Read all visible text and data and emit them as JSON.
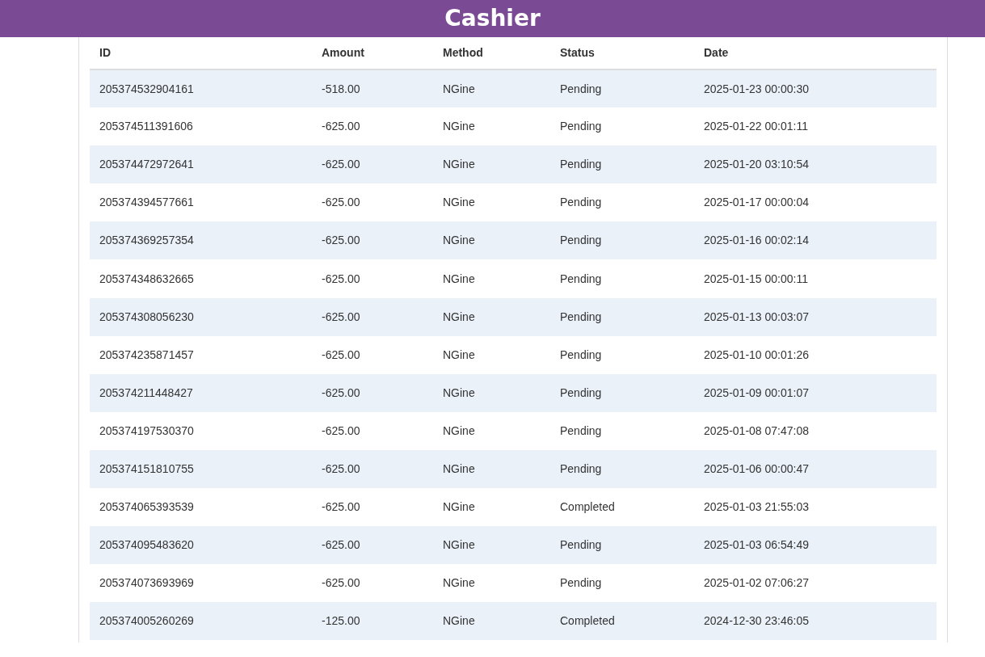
{
  "header": {
    "title": "Cashier"
  },
  "table": {
    "columns": [
      "ID",
      "Amount",
      "Method",
      "Status",
      "Date"
    ],
    "rows": [
      [
        "205374532904161",
        "-518.00",
        "NGine",
        "Pending",
        "2025-01-23 00:00:30"
      ],
      [
        "205374511391606",
        "-625.00",
        "NGine",
        "Pending",
        "2025-01-22 00:01:11"
      ],
      [
        "205374472972641",
        "-625.00",
        "NGine",
        "Pending",
        "2025-01-20 03:10:54"
      ],
      [
        "205374394577661",
        "-625.00",
        "NGine",
        "Pending",
        "2025-01-17 00:00:04"
      ],
      [
        "205374369257354",
        "-625.00",
        "NGine",
        "Pending",
        "2025-01-16 00:02:14"
      ],
      [
        "205374348632665",
        "-625.00",
        "NGine",
        "Pending",
        "2025-01-15 00:00:11"
      ],
      [
        "205374308056230",
        "-625.00",
        "NGine",
        "Pending",
        "2025-01-13 00:03:07"
      ],
      [
        "205374235871457",
        "-625.00",
        "NGine",
        "Pending",
        "2025-01-10 00:01:26"
      ],
      [
        "205374211448427",
        "-625.00",
        "NGine",
        "Pending",
        "2025-01-09 00:01:07"
      ],
      [
        "205374197530370",
        "-625.00",
        "NGine",
        "Pending",
        "2025-01-08 07:47:08"
      ],
      [
        "205374151810755",
        "-625.00",
        "NGine",
        "Pending",
        "2025-01-06 00:00:47"
      ],
      [
        "205374065393539",
        "-625.00",
        "NGine",
        "Completed",
        "2025-01-03 21:55:03"
      ],
      [
        "205374095483620",
        "-625.00",
        "NGine",
        "Pending",
        "2025-01-03 06:54:49"
      ],
      [
        "205374073693969",
        "-625.00",
        "NGine",
        "Pending",
        "2025-01-02 07:06:27"
      ],
      [
        "205374005260269",
        "-125.00",
        "NGine",
        "Completed",
        "2024-12-30 23:46:05"
      ]
    ]
  }
}
